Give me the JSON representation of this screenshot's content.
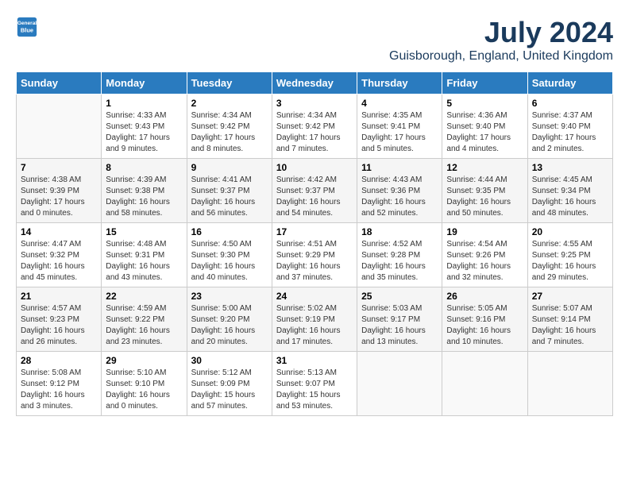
{
  "logo": {
    "line1": "General",
    "line2": "Blue"
  },
  "title": "July 2024",
  "location": "Guisborough, England, United Kingdom",
  "days_of_week": [
    "Sunday",
    "Monday",
    "Tuesday",
    "Wednesday",
    "Thursday",
    "Friday",
    "Saturday"
  ],
  "weeks": [
    [
      {
        "day": "",
        "info": ""
      },
      {
        "day": "1",
        "info": "Sunrise: 4:33 AM\nSunset: 9:43 PM\nDaylight: 17 hours\nand 9 minutes."
      },
      {
        "day": "2",
        "info": "Sunrise: 4:34 AM\nSunset: 9:42 PM\nDaylight: 17 hours\nand 8 minutes."
      },
      {
        "day": "3",
        "info": "Sunrise: 4:34 AM\nSunset: 9:42 PM\nDaylight: 17 hours\nand 7 minutes."
      },
      {
        "day": "4",
        "info": "Sunrise: 4:35 AM\nSunset: 9:41 PM\nDaylight: 17 hours\nand 5 minutes."
      },
      {
        "day": "5",
        "info": "Sunrise: 4:36 AM\nSunset: 9:40 PM\nDaylight: 17 hours\nand 4 minutes."
      },
      {
        "day": "6",
        "info": "Sunrise: 4:37 AM\nSunset: 9:40 PM\nDaylight: 17 hours\nand 2 minutes."
      }
    ],
    [
      {
        "day": "7",
        "info": "Sunrise: 4:38 AM\nSunset: 9:39 PM\nDaylight: 17 hours\nand 0 minutes."
      },
      {
        "day": "8",
        "info": "Sunrise: 4:39 AM\nSunset: 9:38 PM\nDaylight: 16 hours\nand 58 minutes."
      },
      {
        "day": "9",
        "info": "Sunrise: 4:41 AM\nSunset: 9:37 PM\nDaylight: 16 hours\nand 56 minutes."
      },
      {
        "day": "10",
        "info": "Sunrise: 4:42 AM\nSunset: 9:37 PM\nDaylight: 16 hours\nand 54 minutes."
      },
      {
        "day": "11",
        "info": "Sunrise: 4:43 AM\nSunset: 9:36 PM\nDaylight: 16 hours\nand 52 minutes."
      },
      {
        "day": "12",
        "info": "Sunrise: 4:44 AM\nSunset: 9:35 PM\nDaylight: 16 hours\nand 50 minutes."
      },
      {
        "day": "13",
        "info": "Sunrise: 4:45 AM\nSunset: 9:34 PM\nDaylight: 16 hours\nand 48 minutes."
      }
    ],
    [
      {
        "day": "14",
        "info": "Sunrise: 4:47 AM\nSunset: 9:32 PM\nDaylight: 16 hours\nand 45 minutes."
      },
      {
        "day": "15",
        "info": "Sunrise: 4:48 AM\nSunset: 9:31 PM\nDaylight: 16 hours\nand 43 minutes."
      },
      {
        "day": "16",
        "info": "Sunrise: 4:50 AM\nSunset: 9:30 PM\nDaylight: 16 hours\nand 40 minutes."
      },
      {
        "day": "17",
        "info": "Sunrise: 4:51 AM\nSunset: 9:29 PM\nDaylight: 16 hours\nand 37 minutes."
      },
      {
        "day": "18",
        "info": "Sunrise: 4:52 AM\nSunset: 9:28 PM\nDaylight: 16 hours\nand 35 minutes."
      },
      {
        "day": "19",
        "info": "Sunrise: 4:54 AM\nSunset: 9:26 PM\nDaylight: 16 hours\nand 32 minutes."
      },
      {
        "day": "20",
        "info": "Sunrise: 4:55 AM\nSunset: 9:25 PM\nDaylight: 16 hours\nand 29 minutes."
      }
    ],
    [
      {
        "day": "21",
        "info": "Sunrise: 4:57 AM\nSunset: 9:23 PM\nDaylight: 16 hours\nand 26 minutes."
      },
      {
        "day": "22",
        "info": "Sunrise: 4:59 AM\nSunset: 9:22 PM\nDaylight: 16 hours\nand 23 minutes."
      },
      {
        "day": "23",
        "info": "Sunrise: 5:00 AM\nSunset: 9:20 PM\nDaylight: 16 hours\nand 20 minutes."
      },
      {
        "day": "24",
        "info": "Sunrise: 5:02 AM\nSunset: 9:19 PM\nDaylight: 16 hours\nand 17 minutes."
      },
      {
        "day": "25",
        "info": "Sunrise: 5:03 AM\nSunset: 9:17 PM\nDaylight: 16 hours\nand 13 minutes."
      },
      {
        "day": "26",
        "info": "Sunrise: 5:05 AM\nSunset: 9:16 PM\nDaylight: 16 hours\nand 10 minutes."
      },
      {
        "day": "27",
        "info": "Sunrise: 5:07 AM\nSunset: 9:14 PM\nDaylight: 16 hours\nand 7 minutes."
      }
    ],
    [
      {
        "day": "28",
        "info": "Sunrise: 5:08 AM\nSunset: 9:12 PM\nDaylight: 16 hours\nand 3 minutes."
      },
      {
        "day": "29",
        "info": "Sunrise: 5:10 AM\nSunset: 9:10 PM\nDaylight: 16 hours\nand 0 minutes."
      },
      {
        "day": "30",
        "info": "Sunrise: 5:12 AM\nSunset: 9:09 PM\nDaylight: 15 hours\nand 57 minutes."
      },
      {
        "day": "31",
        "info": "Sunrise: 5:13 AM\nSunset: 9:07 PM\nDaylight: 15 hours\nand 53 minutes."
      },
      {
        "day": "",
        "info": ""
      },
      {
        "day": "",
        "info": ""
      },
      {
        "day": "",
        "info": ""
      }
    ]
  ]
}
